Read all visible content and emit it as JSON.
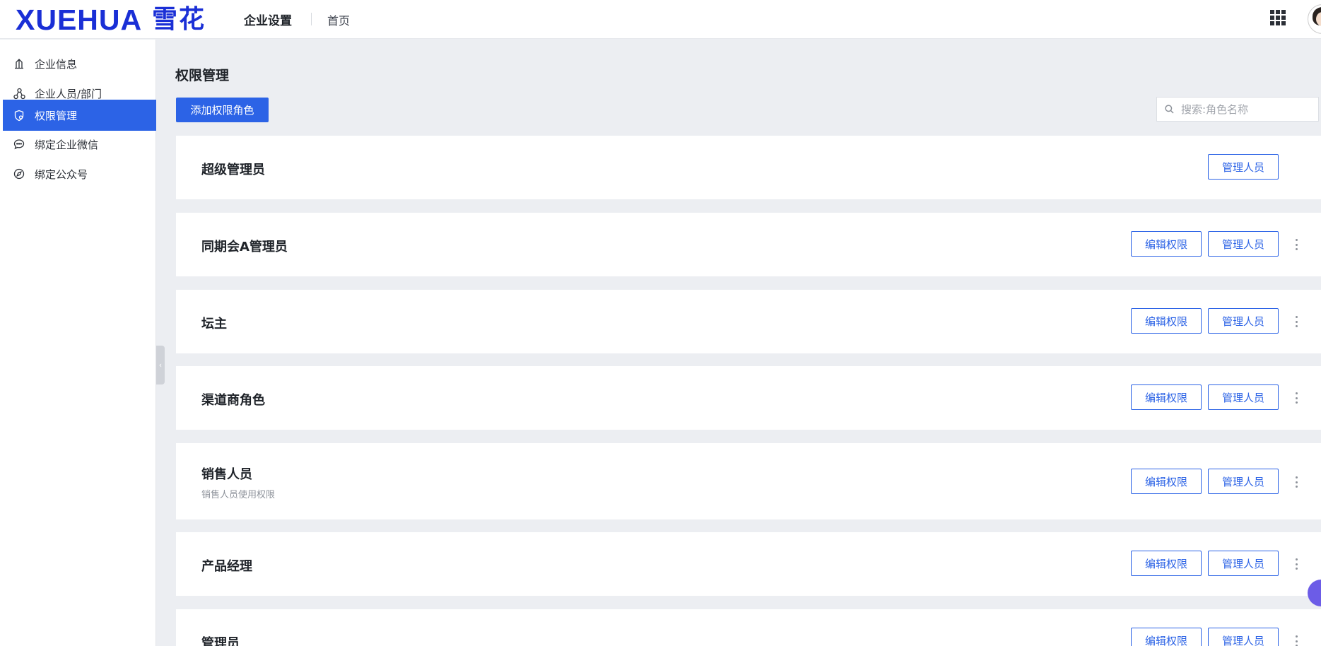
{
  "header": {
    "logo_en": "XUEHUA",
    "logo_cn": "雪花",
    "title": "企业设置",
    "home_link": "首页"
  },
  "sidebar": {
    "items": [
      {
        "label": "企业信息",
        "icon": "building-icon",
        "active": false
      },
      {
        "label": "企业人员/部门",
        "icon": "org-chart-icon",
        "active": false
      },
      {
        "label": "权限管理",
        "icon": "shield-icon",
        "active": true
      },
      {
        "label": "绑定企业微信",
        "icon": "chat-bubble-icon",
        "active": false
      },
      {
        "label": "绑定公众号",
        "icon": "compass-icon",
        "active": false
      }
    ]
  },
  "main": {
    "page_title": "权限管理",
    "add_button": "添加权限角色",
    "search_placeholder": "搜索:角色名称",
    "edit_label": "编辑权限",
    "manage_label": "管理人员",
    "roles": [
      {
        "name": "超级管理员",
        "description": "",
        "editable": false
      },
      {
        "name": "同期会A管理员",
        "description": "",
        "editable": true
      },
      {
        "name": "坛主",
        "description": "",
        "editable": true
      },
      {
        "name": "渠道商角色",
        "description": "",
        "editable": true
      },
      {
        "name": "销售人员",
        "description": "销售人员使用权限",
        "editable": true
      },
      {
        "name": "产品经理",
        "description": "",
        "editable": true
      },
      {
        "name": "管理员",
        "description": "",
        "editable": true
      }
    ]
  },
  "colors": {
    "brand": "#1a2fd6",
    "primary": "#2c63e6",
    "background": "#eceef2"
  }
}
